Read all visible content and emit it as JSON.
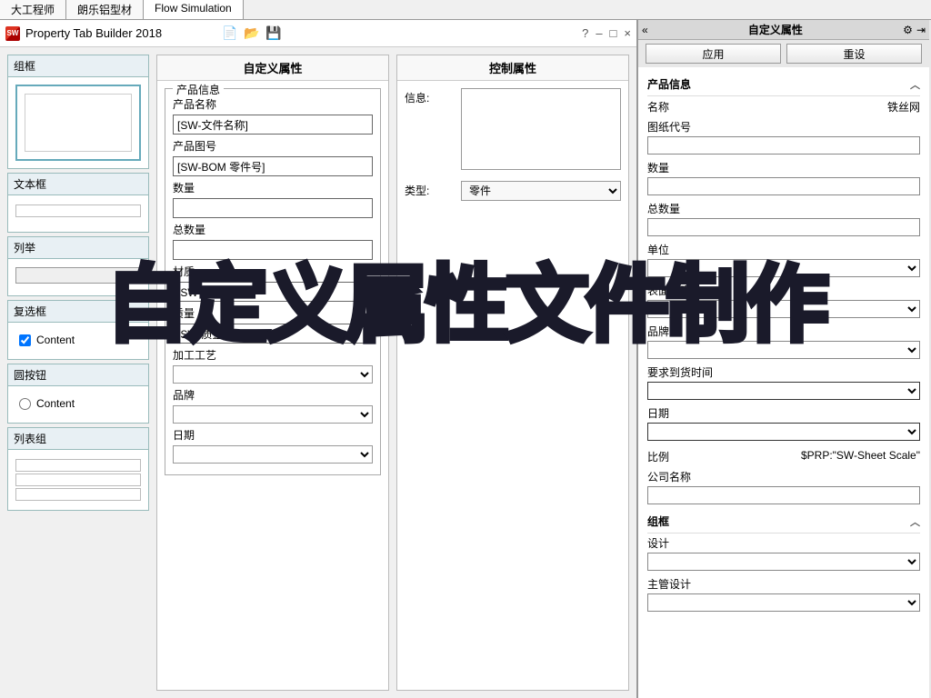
{
  "topTabs": {
    "t1": "大工程师",
    "t2": "朗乐铝型材",
    "t3": "Flow Simulation"
  },
  "titlebar": {
    "title": "Property Tab Builder 2018",
    "help": "?",
    "min": "–",
    "max": "□",
    "close": "×"
  },
  "palette": {
    "groupbox": "组框",
    "textbox": "文本框",
    "list": "列举",
    "checkbox": "复选框",
    "checkboxContent": "Content",
    "radio": "圆按钮",
    "radioContent": "Content",
    "listgroup": "列表组"
  },
  "center": {
    "header": "自定义属性",
    "groupTitle": "产品信息",
    "fields": [
      {
        "label": "产品名称",
        "value": "[SW-文件名称]",
        "type": "input"
      },
      {
        "label": "产品图号",
        "value": "[SW-BOM 零件号]",
        "type": "input"
      },
      {
        "label": "数量",
        "value": "",
        "type": "input"
      },
      {
        "label": "总数量",
        "value": "",
        "type": "input"
      },
      {
        "label": "材质",
        "value": "[SW-材质]",
        "type": "input"
      },
      {
        "label": "质量",
        "value": "[SW-质量]",
        "type": "input"
      },
      {
        "label": "加工工艺",
        "value": "",
        "type": "select"
      },
      {
        "label": "品牌",
        "value": "",
        "type": "select"
      },
      {
        "label": "日期",
        "value": "",
        "type": "select"
      }
    ]
  },
  "control": {
    "header": "控制属性",
    "infoLabel": "信息:",
    "typeLabel": "类型:",
    "typeValue": "零件"
  },
  "rightPanel": {
    "title": "自定义属性",
    "applyBtn": "应用",
    "resetBtn": "重设",
    "section1": "产品信息",
    "nameLabel": "名称",
    "nameValue": "铁丝网",
    "fields1": [
      "图纸代号",
      "数量",
      "总数量",
      "单位",
      "表面处理"
    ],
    "brand": "品牌",
    "reqDate": "要求到货时间",
    "date": "日期",
    "scaleLabel": "比例",
    "scaleValue": "$PRP:\"SW-Sheet Scale\"",
    "company": "公司名称",
    "section2": "组框",
    "design": "设计",
    "chiefDesign": "主管设计"
  },
  "overlay": "自定义属性文件制作"
}
